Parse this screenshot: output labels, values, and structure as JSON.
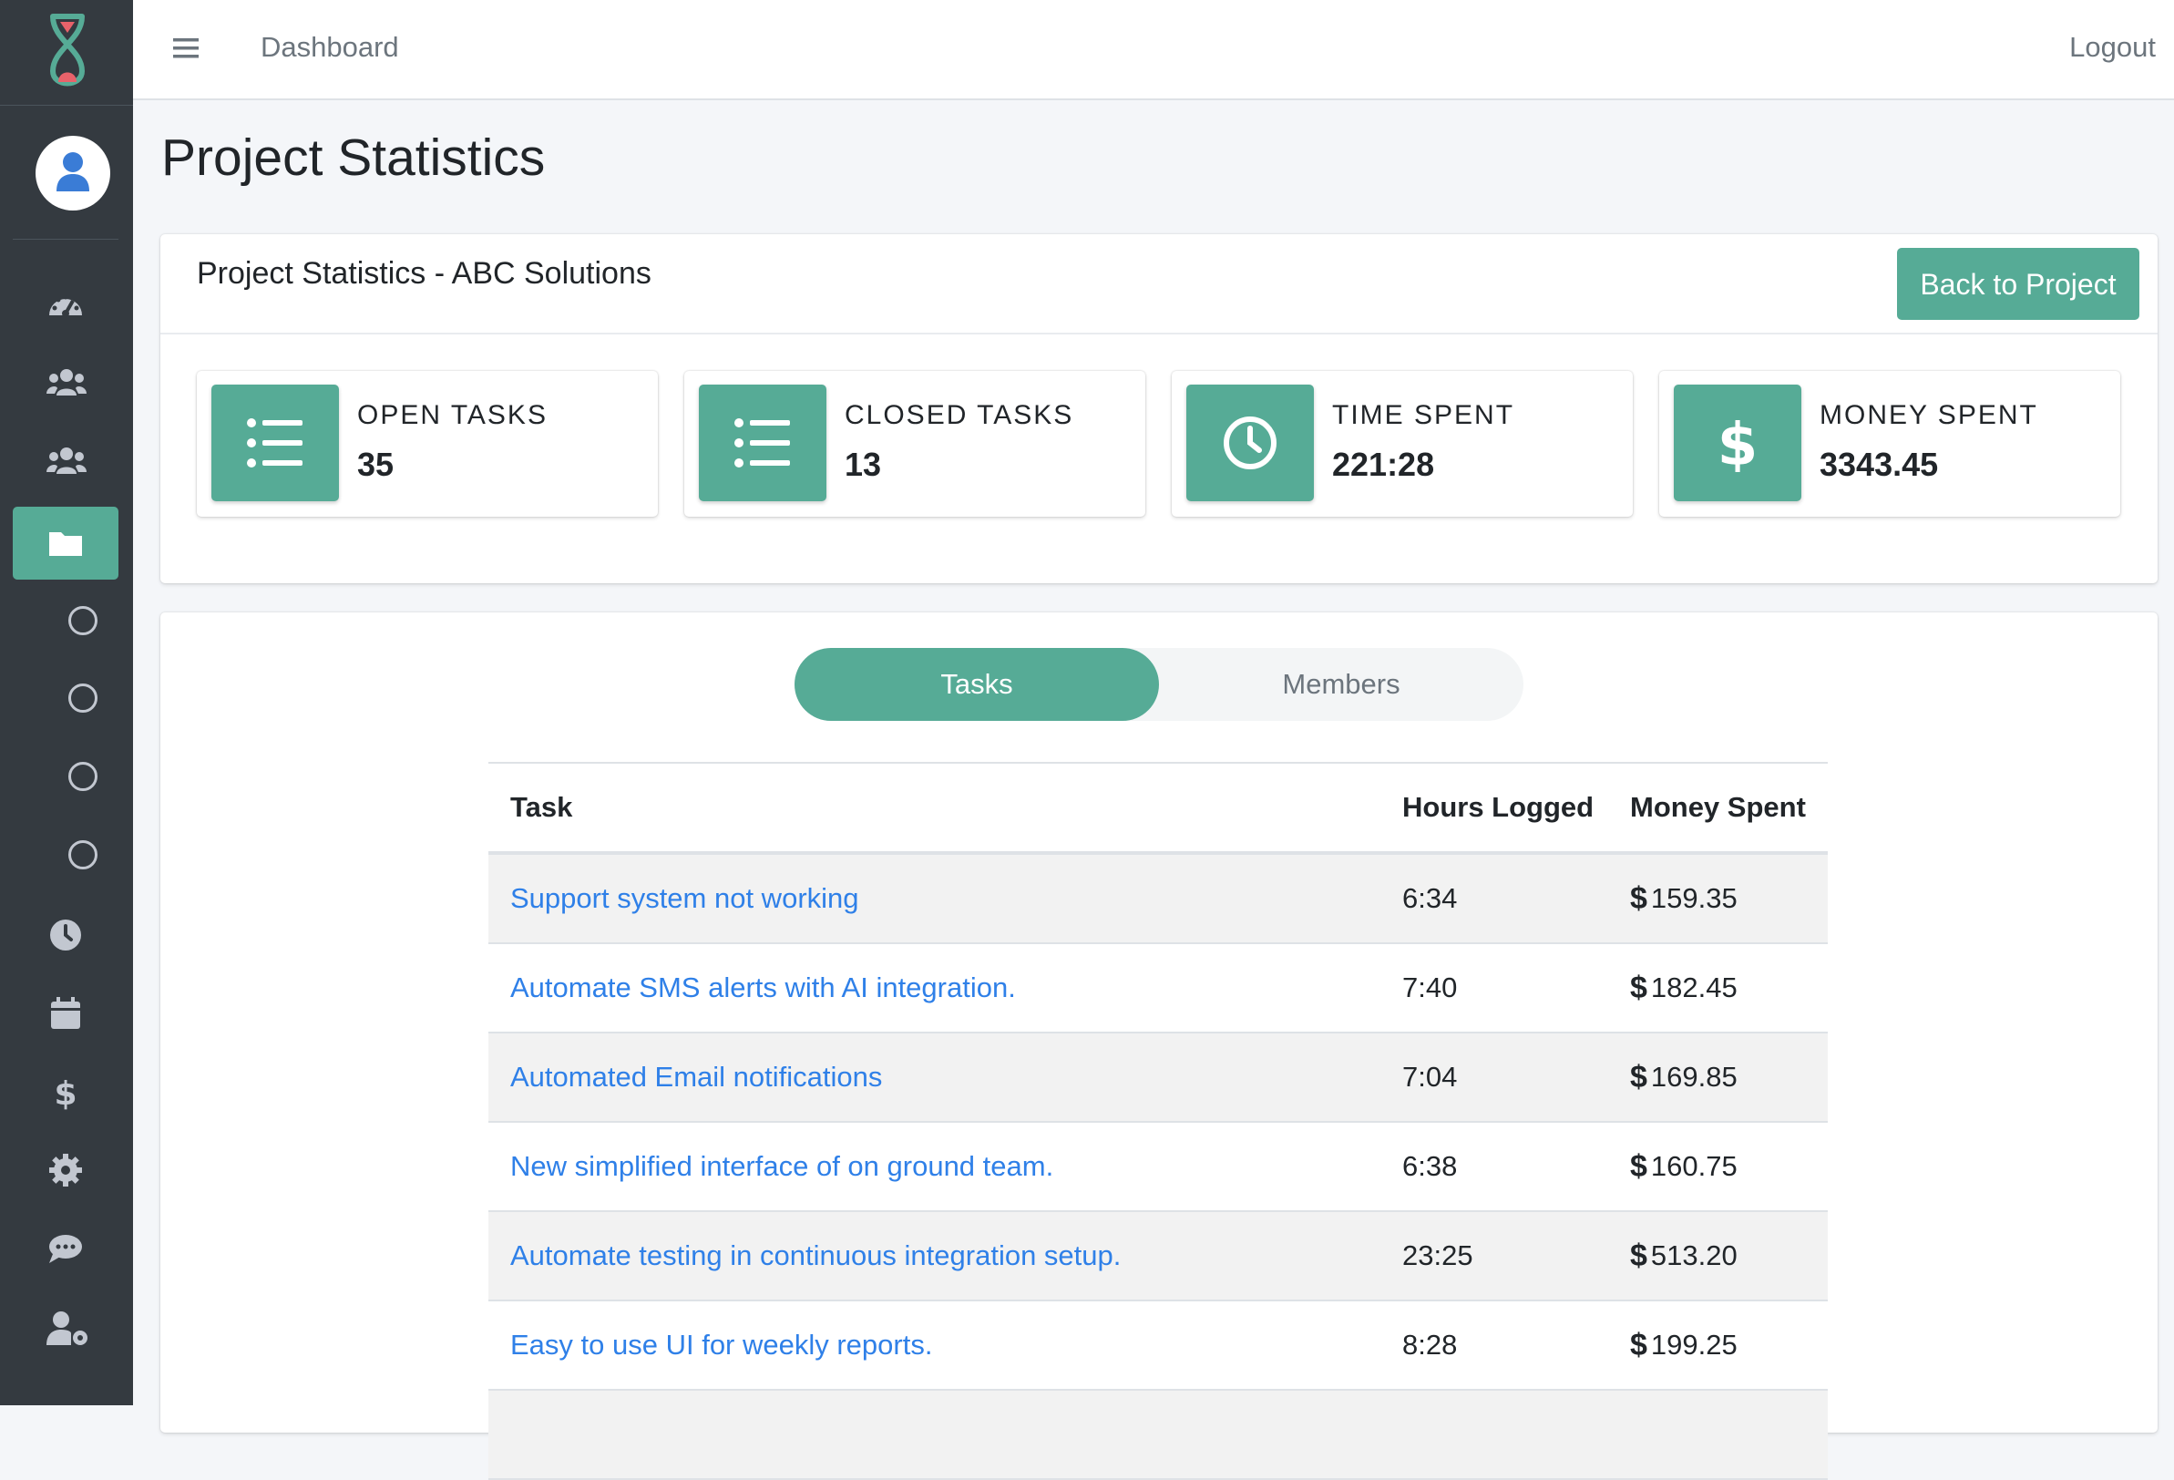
{
  "topbar": {
    "nav_link": "Dashboard",
    "logout": "Logout"
  },
  "sidebar": {
    "nav_icons": [
      "dashboard-icon",
      "clients-icon",
      "teams-icon",
      "projects-icon",
      "subitem-1",
      "subitem-2",
      "subitem-3",
      "subitem-4",
      "time-icon",
      "calendar-icon",
      "finance-icon",
      "settings-icon",
      "messages-icon",
      "user-settings-icon"
    ],
    "active_item": "projects-icon"
  },
  "page": {
    "title": "Project Statistics"
  },
  "summary_card": {
    "title": "Project Statistics - ABC Solutions",
    "back_button": "Back to Project",
    "stats": [
      {
        "label": "OPEN TASKS",
        "value": "35",
        "icon": "list-icon"
      },
      {
        "label": "CLOSED TASKS",
        "value": "13",
        "icon": "list-icon"
      },
      {
        "label": "TIME SPENT",
        "value": "221:28",
        "icon": "clock-icon"
      },
      {
        "label": "MONEY SPENT",
        "value": "3343.45",
        "icon": "dollar-icon"
      }
    ]
  },
  "tabs": {
    "tasks": "Tasks",
    "members": "Members",
    "active": "Tasks"
  },
  "table": {
    "headers": {
      "task": "Task",
      "hours": "Hours Logged",
      "money": "Money Spent"
    },
    "currency": "$",
    "rows": [
      {
        "task": "Support system not working",
        "hours": "6:34",
        "money": "159.35"
      },
      {
        "task": "Automate SMS alerts with AI integration.",
        "hours": "7:40",
        "money": "182.45"
      },
      {
        "task": "Automated Email notifications",
        "hours": "7:04",
        "money": "169.85"
      },
      {
        "task": "New simplified interface of on ground team.",
        "hours": "6:38",
        "money": "160.75"
      },
      {
        "task": "Automate testing in continuous integration setup.",
        "hours": "23:25",
        "money": "513.20"
      },
      {
        "task": "Easy to use UI for weekly reports.",
        "hours": "8:28",
        "money": "199.25"
      }
    ]
  },
  "colors": {
    "accent": "#56ab96",
    "sidebar": "#343a40",
    "link": "#2f80e8"
  }
}
